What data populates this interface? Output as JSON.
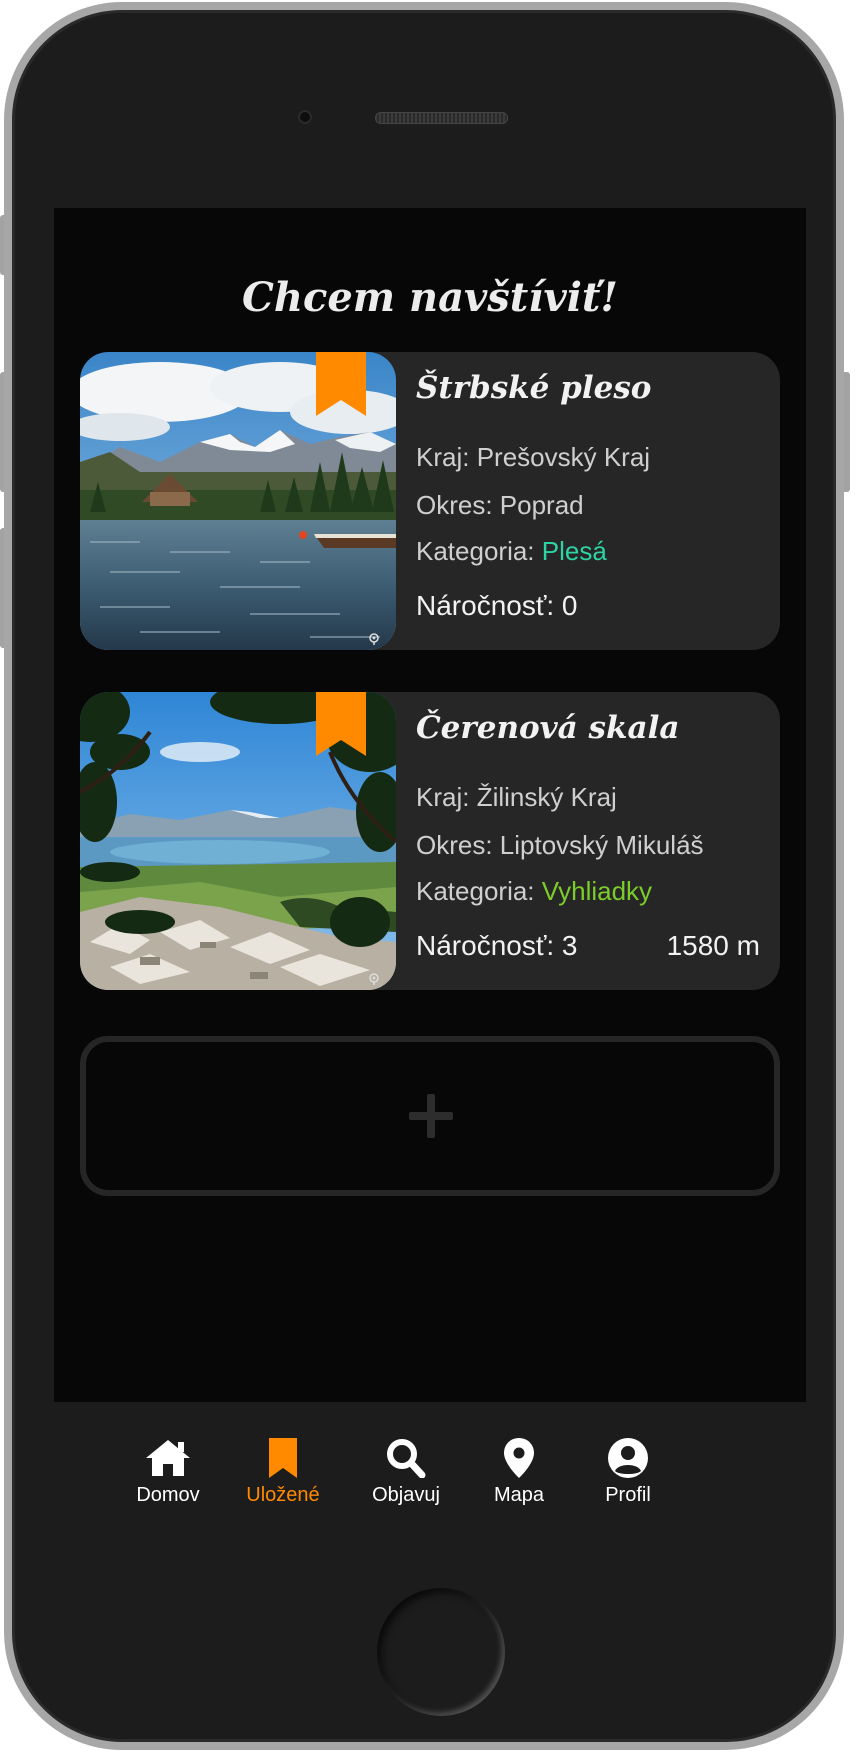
{
  "page": {
    "title": "Chcem navštíviť!"
  },
  "colors": {
    "accent": "#ff8a00",
    "category_plesa": "#2ed3a3",
    "category_vyhliadky": "#7ccc2a",
    "card_bg": "#262626",
    "screen_bg": "#070707",
    "nav_bg": "#1c1c1c"
  },
  "cards": [
    {
      "title": "Štrbské pleso",
      "kraj_label": "Kraj: ",
      "kraj_value": "Prešovský Kraj",
      "okres_label": "Okres: ",
      "okres_value": "Poprad",
      "kategoria_label": "Kategoria: ",
      "kategoria_value": "Plesá",
      "narocnost": "Náročnosť: 0",
      "altitude": "",
      "image": "mountain-lake-photo",
      "saved_icon": "bookmark-icon"
    },
    {
      "title": "Čerenová skala",
      "kraj_label": "Kraj: ",
      "kraj_value": "Žilinský Kraj",
      "okres_label": "Okres: ",
      "okres_value": "Liptovský Mikuláš",
      "kategoria_label": "Kategoria: ",
      "kategoria_value": "Vyhliadky",
      "narocnost": "Náročnosť: 3",
      "altitude": "1580 m",
      "image": "valley-viewpoint-photo",
      "saved_icon": "bookmark-icon"
    }
  ],
  "add_card": {
    "icon": "plus-icon"
  },
  "nav": {
    "items": [
      {
        "label": "Domov",
        "icon": "home-icon",
        "active": false
      },
      {
        "label": "Uložené",
        "icon": "bookmark-icon",
        "active": true
      },
      {
        "label": "Objavuj",
        "icon": "search-icon",
        "active": false
      },
      {
        "label": "Mapa",
        "icon": "map-pin-icon",
        "active": false
      },
      {
        "label": "Profil",
        "icon": "profile-icon",
        "active": false
      }
    ]
  }
}
